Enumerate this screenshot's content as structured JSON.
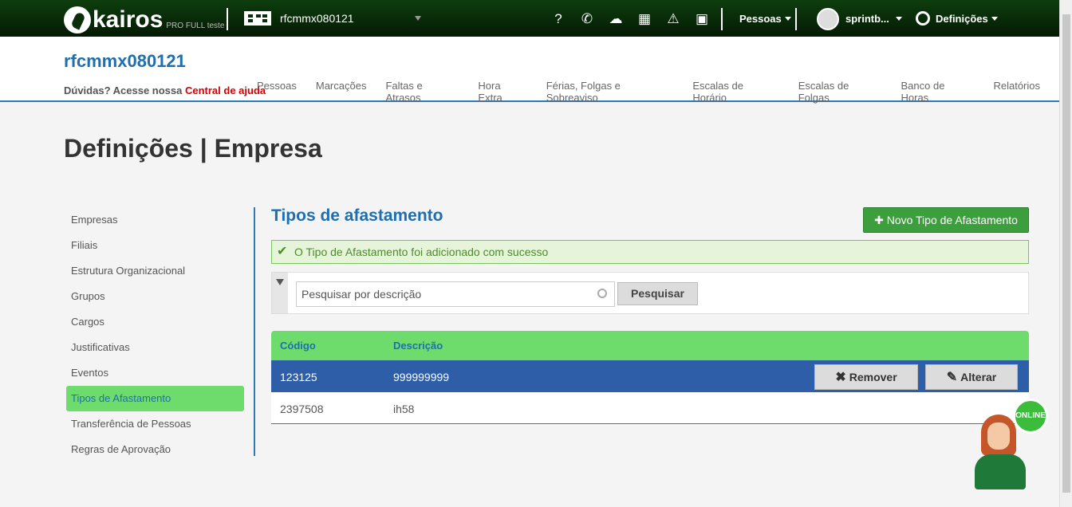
{
  "topbar": {
    "logo_text": "kairos",
    "logo_sub": "PRO FULL teste",
    "company": "rfcmmx080121",
    "icons": [
      "help-icon",
      "chat-icon",
      "cloud-download-icon",
      "calculator-icon",
      "warning-icon",
      "inbox-icon"
    ],
    "pessoas_label": "Pessoas",
    "user_label": "sprintb...",
    "settings_label": "Definições"
  },
  "header": {
    "company_title": "rfcmmx080121",
    "help_text": "Dúvidas? Acesse nossa ",
    "help_link": "Central de ajuda",
    "nav": [
      "Pessoas",
      "Marcações",
      "Faltas e Atrasos",
      "Hora Extra",
      "Férias, Folgas e Sobreaviso",
      "Escalas de Horário",
      "Escalas de Folgas",
      "Banco de Horas",
      "Relatórios"
    ]
  },
  "page": {
    "title": "Definições | Empresa"
  },
  "sidebar": {
    "items": [
      "Empresas",
      "Filiais",
      "Estrutura Organizacional",
      "Grupos",
      "Cargos",
      "Justificativas",
      "Eventos",
      "Tipos de Afastamento",
      "Transferência de Pessoas",
      "Regras de Aprovação"
    ],
    "active": "Tipos de Afastamento"
  },
  "main": {
    "section_title": "Tipos de afastamento",
    "new_button": "Novo Tipo de Afastamento",
    "alert": "O Tipo de Afastamento foi adicionado com sucesso",
    "search_placeholder": "Pesquisar por descrição",
    "search_button": "Pesquisar",
    "table": {
      "headers": [
        "Código",
        "Descrição"
      ],
      "rows": [
        {
          "code": "123125",
          "description": "999999999"
        },
        {
          "code": "2397508",
          "description": "ih58"
        }
      ],
      "remove_label": "Remover",
      "edit_label": "Alterar"
    }
  },
  "chat": {
    "status": "ONLINE"
  },
  "colors": {
    "accent": "#1f6fb0",
    "active_green": "#6ddc6d",
    "selected_row": "#2f5ea8",
    "button_green": "#3c9e3c"
  }
}
